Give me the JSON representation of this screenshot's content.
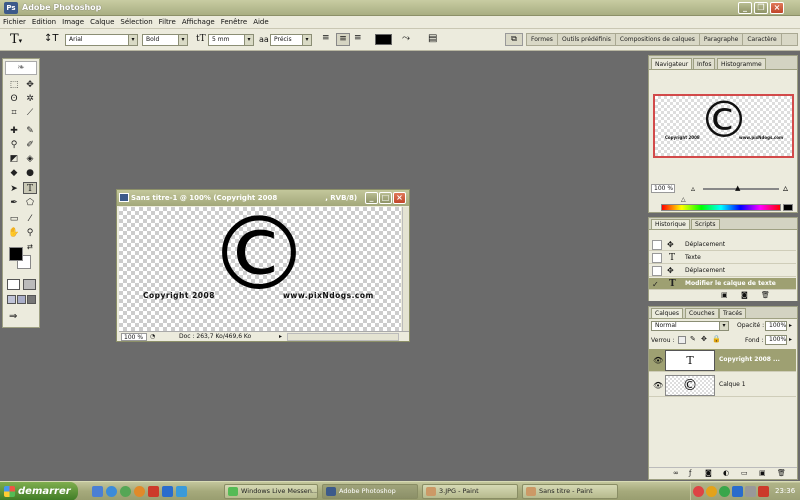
{
  "window": {
    "title": "Adobe Photoshop"
  },
  "menu": [
    "Fichier",
    "Edition",
    "Image",
    "Calque",
    "Sélection",
    "Filtre",
    "Affichage",
    "Fenêtre",
    "Aide"
  ],
  "options": {
    "font_family": "Arial",
    "font_style": "Bold",
    "font_size": "5 mm",
    "antialias_label": "a",
    "antialias": "Précis",
    "color": "#000000"
  },
  "well_tabs": [
    "Formes",
    "Outils prédéfinis",
    "Compositions de calques",
    "Paragraphe",
    "Caractère"
  ],
  "document": {
    "title": "Sans titre-1 @ 100% (Copyright 2008",
    "mode": ", RVB/8)",
    "symbol": "©",
    "text_left": "Copyright 2008",
    "text_right": "www.pixNdogs.com",
    "zoom": "100 %",
    "doc_size": "Doc : 263,7 Ko/469,6 Ko"
  },
  "navigator": {
    "tabs": [
      "Navigateur",
      "Infos",
      "Histogramme"
    ],
    "zoom": "100 %",
    "thumb_text_left": "Copyright 2008",
    "thumb_text_right": "www.pixNdogs.com"
  },
  "history": {
    "tabs": [
      "Historique",
      "Scripts"
    ],
    "items": [
      {
        "label": "Déplacement",
        "icon": "move-icon"
      },
      {
        "label": "Texte",
        "icon": "type-icon"
      },
      {
        "label": "Déplacement",
        "icon": "move-icon"
      },
      {
        "label": "Modifier le calque de texte",
        "icon": "type-icon",
        "active": true
      }
    ]
  },
  "layers": {
    "tabs": [
      "Calques",
      "Couches",
      "Tracés"
    ],
    "blend_mode": "Normal",
    "opacity_label": "Opacité :",
    "opacity": "100%",
    "lock_label": "Verrou :",
    "fill_label": "Fond :",
    "fill": "100%",
    "items": [
      {
        "name": "Copyright 2008 ...",
        "thumb": "T",
        "active": true
      },
      {
        "name": "Calque 1",
        "thumb": "©",
        "active": false
      }
    ]
  },
  "taskbar": {
    "start": "demarrer",
    "buttons": [
      "Windows Live Messen...",
      "Adobe Photoshop",
      "3.JPG - Paint",
      "Sans titre - Paint"
    ],
    "clock": "23:36"
  },
  "colors": {
    "olive": "#a6ab7e",
    "panel": "#ecebdd",
    "workspace": "#6b6b6b",
    "active_row": "#9ea072"
  }
}
